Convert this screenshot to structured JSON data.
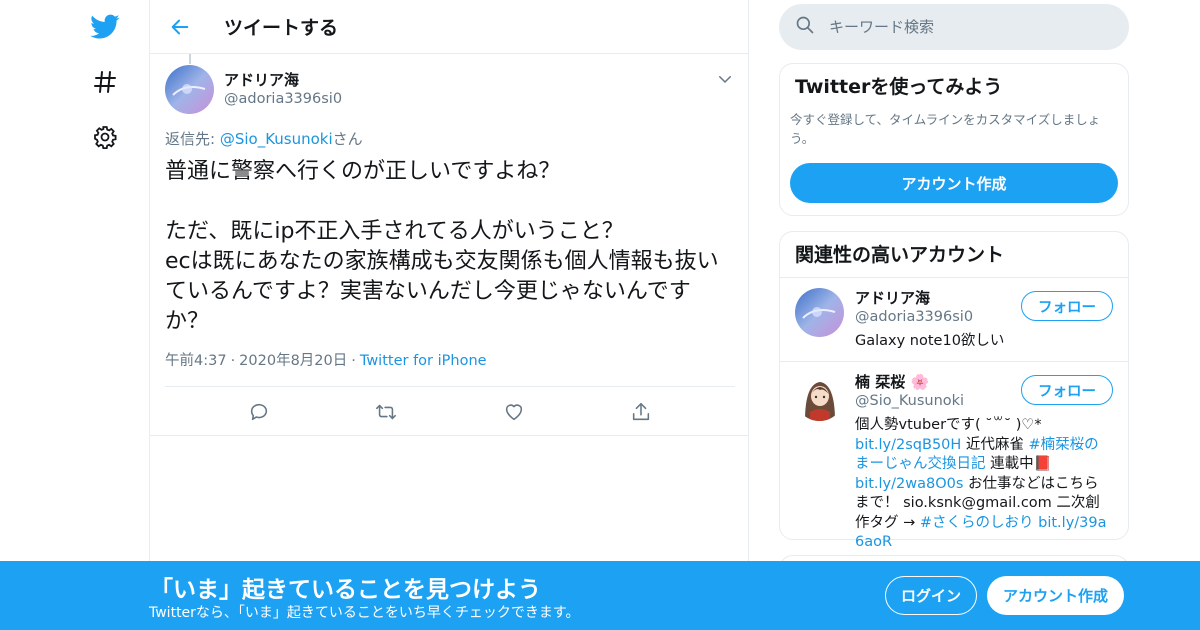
{
  "nav": {
    "icons": [
      "twitter-bird-icon",
      "hashtag-icon",
      "gear-icon"
    ]
  },
  "header": {
    "title": "ツイートする"
  },
  "tweet": {
    "author_name": "アドリア海",
    "author_handle": "@adoria3396si0",
    "reply_prefix": "返信先: ",
    "reply_target": "@Sio_Kusunoki",
    "reply_suffix": "さん",
    "body": "普通に警察へ行くのが正しいですよね？\n\nただ、既にip不正入手されてる人がいうこと？\necは既にあなたの家族構成も交友関係も個人情報も抜いているんですよ？実害ないんだし今更じゃないんですか？",
    "time": "午前4:37",
    "date": "2020年8月20日",
    "source": "Twitter for iPhone",
    "actions": [
      "reply-icon",
      "retweet-icon",
      "like-icon",
      "share-icon"
    ]
  },
  "search": {
    "placeholder": "キーワード検索"
  },
  "signup_card": {
    "title": "Twitterを使ってみよう",
    "desc": "今すぐ登録して、タイムラインをカスタマイズしましょう。",
    "button": "アカウント作成"
  },
  "related": {
    "title": "関連性の高いアカウント",
    "follow_label": "フォロー",
    "accounts": [
      {
        "name": "アドリア海",
        "handle": "@adoria3396si0",
        "bio": "Galaxy note10欲しい"
      },
      {
        "name": "楠 栞桜",
        "name_emoji": "🌸",
        "handle": "@Sio_Kusunoki",
        "bio_1": "個人勢vtuberです( ˘꒳˘ )♡*",
        "link_1": "bit.ly/2sqB50H",
        "bio_2": " 近代麻雀 ",
        "tag_1": "#楠栞桜のまーじゃん交換日記",
        "bio_3": " 連載中",
        "bio_emoji": "📕",
        "link_2": "bit.ly/2wa8O0s",
        "bio_4": " お仕事などはこちらまで！ sio.ksnk@gmail.com 二次創作タグ → ",
        "tag_2": "#さくらのしおり",
        "link_3": "bit.ly/39a6aoR"
      }
    ]
  },
  "banner": {
    "headline": "「いま」起きていることを見つけよう",
    "subtext": "Twitterなら、「いま」起きていることをいち早くチェックできます。",
    "login": "ログイン",
    "signup": "アカウント作成"
  },
  "colors": {
    "brand": "#1da1f2",
    "link": "#1b95e0",
    "muted": "#657786",
    "border": "#e6ecf0"
  }
}
